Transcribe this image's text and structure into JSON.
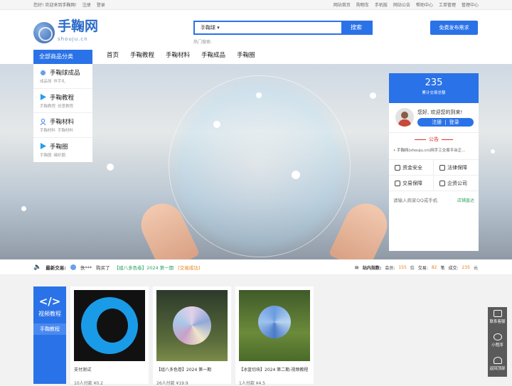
{
  "topbar": {
    "greeting": "您好! 欢迎来到手鞠网!",
    "register": "注册",
    "login": "登录",
    "links": [
      "网站首页",
      "购物车",
      "手机版",
      "网站公告",
      "帮助中心",
      "工单管理"
    ],
    "admin": "管理中心"
  },
  "logo": {
    "cn": "手鞠网",
    "en": "shouju.cn"
  },
  "search": {
    "category": "手鞠球",
    "button": "搜索",
    "hot_label": "热门搜索:"
  },
  "publish_button": "免费发布需求",
  "nav": {
    "all_categories": "全部商品分类",
    "items": [
      "首页",
      "手鞠教程",
      "手鞠材料",
      "手鞠成品",
      "手鞠圈"
    ]
  },
  "side_categories": [
    {
      "title": "手鞠球成品",
      "subs": [
        "成品球",
        "伴手礼"
      ]
    },
    {
      "title": "手鞠教程",
      "subs": [
        "手鞠教程",
        "创意教程"
      ]
    },
    {
      "title": "手鞠材料",
      "subs": [
        "手鞠材料",
        "手鞠材料"
      ]
    },
    {
      "title": "手鞠圈",
      "subs": [
        "手鞠圈",
        "编织圈"
      ]
    }
  ],
  "right_panel": {
    "stat_number": "235",
    "stat_label": "累计交易总额",
    "welcome": "您好, 欢迎您的到来!",
    "register": "注册",
    "login": "登录",
    "notice_title": "公告",
    "notice_text": "手鞠网(shouju.cn)网手工交易平台正...",
    "features": [
      "资金安全",
      "法律保障",
      "交易保障",
      "企资公司"
    ],
    "qq_placeholder": "请输入商家QQ或手机",
    "qq_link": "店铺直达"
  },
  "ticker": {
    "label": "最新交易:",
    "user": "佚***",
    "action": "购买了",
    "item": "【组八多色卷】2024 第一期",
    "status": "[交易成功]",
    "index_label": "站内指数:",
    "members_label": "会员:",
    "members": "155",
    "members_unit": "位",
    "trades_label": "交易:",
    "trades": "82",
    "trades_unit": "笔",
    "deals_label": "成交:",
    "deals": "235",
    "deals_unit": "元"
  },
  "video_section": {
    "title": "视频教程",
    "sub": "手鞠教程"
  },
  "cards": [
    {
      "title": "支付测试",
      "foot": "10人付款  ¥0.2"
    },
    {
      "title": "【组八多色卷】2024 第一期",
      "foot": "26人付款  ¥19.9"
    },
    {
      "title": "【冰蓝切块】2024 第二期-视频教程",
      "foot": "1人付款  ¥4.5"
    }
  ],
  "float_side": [
    "联系客服",
    "小程序",
    "返回顶部"
  ]
}
